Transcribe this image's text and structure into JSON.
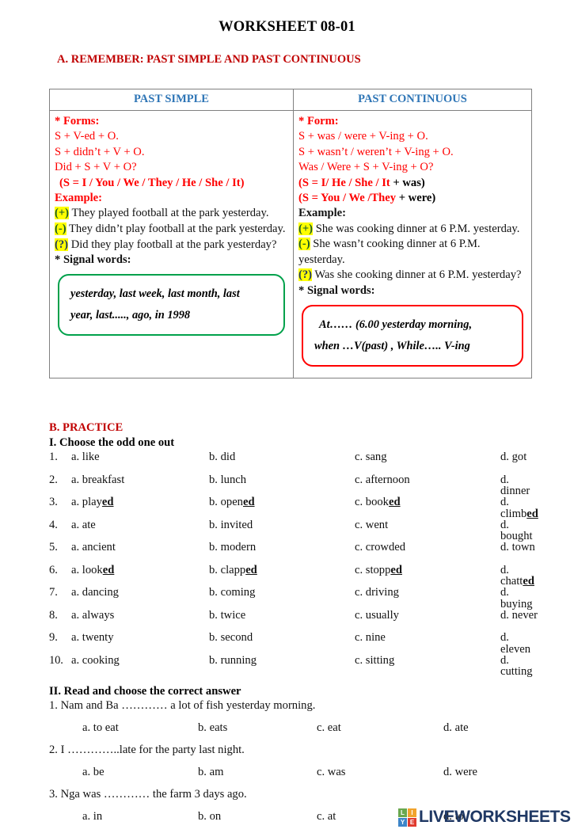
{
  "document": {
    "title": "WORKSHEET 08-01"
  },
  "section_a": {
    "heading": "A. REMEMBER: PAST SIMPLE AND PAST CONTINUOUS",
    "table": {
      "headers": {
        "left": "PAST SIMPLE",
        "right": "PAST CONTINUOUS"
      },
      "past_simple": {
        "forms_label": "* Forms:",
        "forms": [
          "S + V-ed + O.",
          "S + didn’t + V + O.",
          "Did + S + V + O?"
        ],
        "subjects": "(S = I / You / We / They / He / She / It)",
        "example_label": "Example:",
        "examples": [
          {
            "marker": "(+)",
            "text": "They played football at the park yesterday."
          },
          {
            "marker": "(-)",
            "text": "They didn’t play football at the park yesterday."
          },
          {
            "marker": "(?)",
            "text": "Did they play football at the park yesterday?"
          }
        ],
        "signal_label": "* Signal words:",
        "signal_words": [
          "yesterday, last week, last month, last",
          "year, last....., ago, in 1998"
        ],
        "signal_box_color": "#00a14b"
      },
      "past_continuous": {
        "forms_label": "* Form:",
        "forms": [
          "S + was / were + V-ing + O.",
          "S + wasn’t / weren’t + V-ing + O.",
          "Was / Were + S + V-ing + O?"
        ],
        "subjects_1_red": "(S = I/ He / She / It ",
        "subjects_1_black": "+ was)",
        "subjects_2_red": "(S = You / We /They ",
        "subjects_2_black": "+ were)",
        "example_label": "Example:",
        "examples": [
          {
            "marker": "(+)",
            "text": "She was cooking dinner at 6 P.M. yesterday."
          },
          {
            "marker": "(-)",
            "text": "She wasn’t cooking dinner at 6 P.M. yesterday."
          },
          {
            "marker": "(?)",
            "text": "Was she cooking dinner at 6 P.M. yesterday?"
          }
        ],
        "signal_label": "* Signal words:",
        "signal_words": [
          "At…… (6.00 yesterday morning,",
          "when …V(past) , While….. V-ing"
        ],
        "signal_box_color": "#ff0000"
      }
    }
  },
  "section_b": {
    "heading": "B. PRACTICE",
    "part_1": {
      "heading": "I. Choose the odd one out",
      "rows": [
        {
          "num": "1.",
          "a": "a. like",
          "b": "b. did",
          "c": "c. sang",
          "d": "d. got"
        },
        {
          "num": "2.",
          "a": "a. breakfast",
          "b": "b. lunch",
          "c": "c. afternoon",
          "d": "d. dinner"
        },
        {
          "num": "3.",
          "a": "a. play",
          "a_ed": "ed",
          "b": "b. open",
          "b_ed": "ed",
          "c": "c. book",
          "c_ed": "ed",
          "d": "d. climb",
          "d_ed": "ed"
        },
        {
          "num": "4.",
          "a": "a. ate",
          "b": "b. invited",
          "c": "c. went",
          "d": "d. bought"
        },
        {
          "num": "5.",
          "a": "a. ancient",
          "b": "b. modern",
          "c": "c. crowded",
          "d": "d. town"
        },
        {
          "num": "6.",
          "a": "a. look",
          "a_ed": "ed",
          "b": "b. clapp",
          "b_ed": "ed",
          "c": "c. stopp",
          "c_ed": "ed",
          "d": "d. chatt",
          "d_ed": "ed"
        },
        {
          "num": "7.",
          "a": "a. dancing",
          "b": "b. coming",
          "c": "c. driving",
          "d": "d. buying"
        },
        {
          "num": "8.",
          "a": "a. always",
          "b": "b. twice",
          "c": "c. usually",
          "d": "d. never"
        },
        {
          "num": "9.",
          "a": "a. twenty",
          "b": "b. second",
          "c": "c. nine",
          "d": "d. eleven"
        },
        {
          "num": "10.",
          "a": "a. cooking",
          "b": "b. running",
          "c": "c. sitting",
          "d": "d. cutting"
        }
      ]
    },
    "part_2": {
      "heading": "II. Read and choose the correct answer",
      "questions": [
        {
          "stem": "1. Nam and Ba ………… a lot of fish yesterday morning.",
          "options": [
            "a. to eat",
            "b. eats",
            "c. eat",
            "d. ate"
          ]
        },
        {
          "stem": "2. I …………..late for the party last night.",
          "options": [
            "a. be",
            "b. am",
            "c. was",
            "d. were"
          ]
        },
        {
          "stem": "3. Nga was ………… the farm 3 days ago.",
          "options": [
            "a. in",
            "b.  on",
            "c. at",
            "d. to"
          ]
        }
      ]
    }
  },
  "footer": {
    "logo": {
      "squares": [
        {
          "letter": "L",
          "color": "#6aa84f"
        },
        {
          "letter": "I",
          "color": "#f1a32c"
        },
        {
          "letter": "Y",
          "color": "#3d85c8"
        },
        {
          "letter": "E",
          "color": "#e03b2f"
        }
      ],
      "wordmark": "LIVEWORKSHEETS",
      "wordmark_color": "#1f3864"
    }
  }
}
